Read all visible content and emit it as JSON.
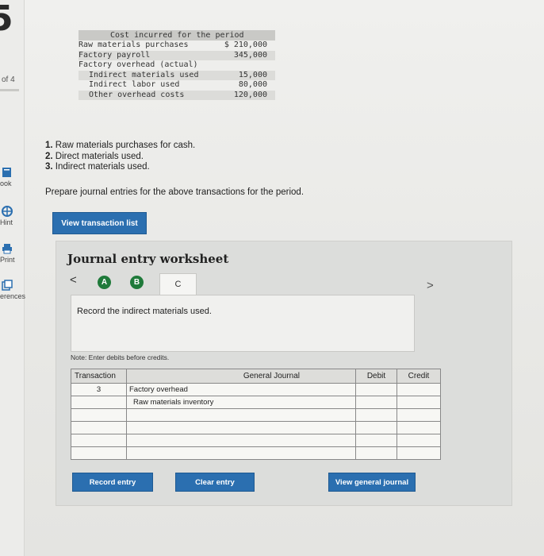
{
  "sidebar": {
    "brand_glyph": "5",
    "page_of": "of 4",
    "tools": [
      {
        "label": "ook",
        "icon": "book-icon"
      },
      {
        "label": "Hint",
        "icon": "globe-icon"
      },
      {
        "label": "Print",
        "icon": "printer-icon"
      },
      {
        "label": "erences",
        "icon": "references-icon"
      }
    ]
  },
  "cost_table": {
    "header": "Cost incurred for the period",
    "rows": [
      {
        "label": "Raw materials purchases",
        "amount": "$ 210,000"
      },
      {
        "label": "Factory payroll",
        "amount": "345,000"
      },
      {
        "label": "Factory overhead (actual)",
        "amount": ""
      },
      {
        "label": "Indirect materials used",
        "amount": "15,000"
      },
      {
        "label": "Indirect labor used",
        "amount": "80,000"
      },
      {
        "label": "Other overhead costs",
        "amount": "120,000"
      }
    ]
  },
  "tasks": [
    {
      "num": "1.",
      "text": "Raw materials purchases for cash."
    },
    {
      "num": "2.",
      "text": "Direct materials used."
    },
    {
      "num": "3.",
      "text": "Indirect materials used."
    }
  ],
  "prompt": "Prepare journal entries for the above transactions for the period.",
  "view_transaction_list": "View transaction list",
  "worksheet": {
    "title": "Journal entry worksheet",
    "tabs": [
      "A",
      "B",
      "C"
    ],
    "record_text": "Record the indirect materials used.",
    "note": "Note: Enter debits before credits.",
    "headers": {
      "transaction": "Transaction",
      "general_journal": "General Journal",
      "debit": "Debit",
      "credit": "Credit"
    },
    "rows": [
      {
        "transaction": "3",
        "account": "Factory overhead",
        "debit": "",
        "credit": ""
      },
      {
        "transaction": "",
        "account": "Raw materials inventory",
        "debit": "",
        "credit": ""
      },
      {
        "transaction": "",
        "account": "",
        "debit": "",
        "credit": ""
      },
      {
        "transaction": "",
        "account": "",
        "debit": "",
        "credit": ""
      },
      {
        "transaction": "",
        "account": "",
        "debit": "",
        "credit": ""
      },
      {
        "transaction": "",
        "account": "",
        "debit": "",
        "credit": ""
      }
    ],
    "buttons": {
      "record": "Record entry",
      "clear": "Clear entry",
      "view_general": "View general journal"
    }
  },
  "colors": {
    "accent_blue": "#2b6fb0",
    "tab_green": "#1f7a3a"
  }
}
